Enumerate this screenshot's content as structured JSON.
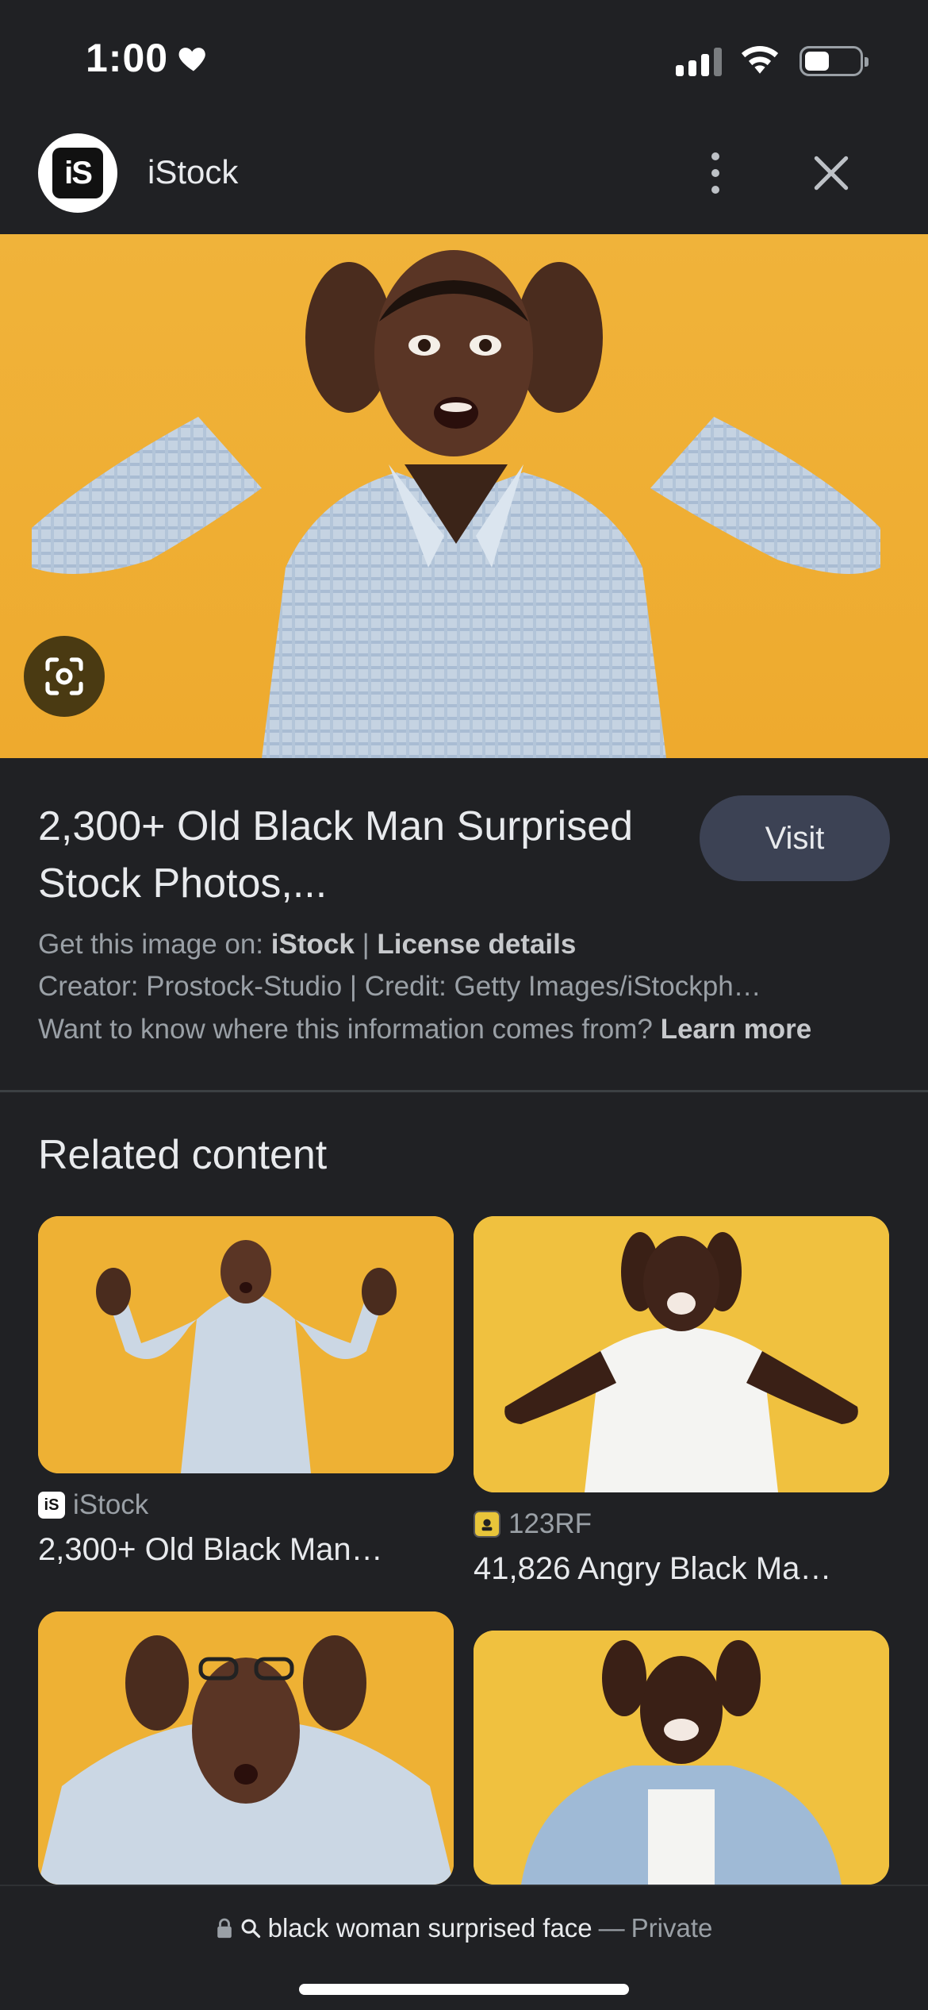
{
  "status": {
    "time": "1:00",
    "battery_level": 0.45
  },
  "header": {
    "site_name": "iStock",
    "logo_text": "iS"
  },
  "result": {
    "title": "2,300+ Old Black Man Surprised Stock Photos,...",
    "visit_label": "Visit",
    "get_image_prefix": "Get this image on:",
    "source_name": "iStock",
    "separator": "|",
    "license_label": "License details",
    "creator_line": "Creator: Prostock-Studio | Credit: Getty Images/iStockph…",
    "info_question": "Want to know where this information comes from?",
    "learn_more": "Learn more"
  },
  "related": {
    "heading": "Related content",
    "cards": [
      {
        "source": "iStock",
        "caption": "2,300+ Old Black Man…"
      },
      {
        "source": "123RF",
        "caption": "41,826 Angry Black Ma…"
      }
    ]
  },
  "url_bar": {
    "query": "black woman surprised face",
    "dash": "—",
    "private": "Private"
  },
  "colors": {
    "background": "#202124",
    "accent_yellow": "#eeb134",
    "visit_button": "#3c4254"
  }
}
